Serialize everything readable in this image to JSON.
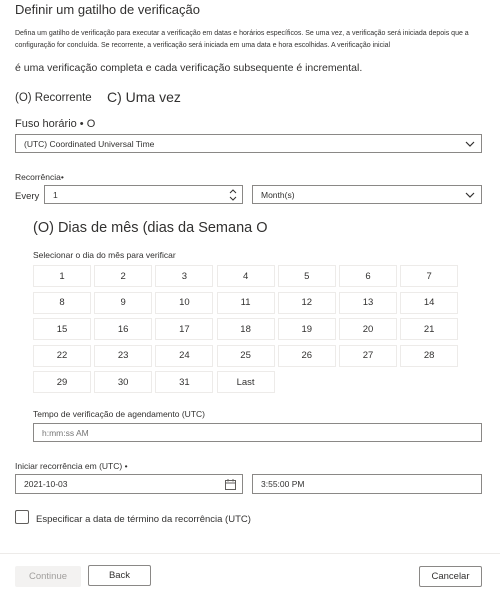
{
  "dialog": {
    "title": "Definir um gatilho de verificação",
    "description": "Defina um gatilho de verificação para executar a verificação em datas e horários específicos. Se uma vez, a verificação será iniciada depois que a configuração for concluída. Se recorrente, a verificação será iniciada em uma data e hora escolhidas. A verificação inicial",
    "description_tail": "é uma verificação completa e cada verificação subsequente é incremental."
  },
  "trigger": {
    "recurring_label": "(O) Recorrente",
    "once_label": "C) Uma vez"
  },
  "timezone": {
    "label": "Fuso horário • O",
    "value": "(UTC) Coordinated Universal Time"
  },
  "recurrence": {
    "label": "Recorrência•",
    "every_label": "Every",
    "interval_value": "1",
    "unit_value": "Month(s)"
  },
  "day_mode": {
    "label": "(O) Dias de mês (dias da Semana O"
  },
  "day_picker": {
    "label": "Selecionar o dia do mês para verificar",
    "days": [
      "1",
      "2",
      "3",
      "4",
      "5",
      "6",
      "7",
      "8",
      "9",
      "10",
      "11",
      "12",
      "13",
      "14",
      "15",
      "16",
      "17",
      "18",
      "19",
      "20",
      "21",
      "22",
      "23",
      "24",
      "25",
      "26",
      "27",
      "28",
      "29",
      "30",
      "31",
      "Last"
    ]
  },
  "schedule_time": {
    "label": "Tempo de verificação de agendamento (UTC)",
    "placeholder": "h:mm:ss AM"
  },
  "start": {
    "label": "Iniciar recorrência em (UTC) •",
    "date_value": "2021-10-03",
    "time_value": "3:55:00 PM"
  },
  "end_date": {
    "label": "Especificar a data de término da recorrência (UTC)"
  },
  "footer": {
    "continue_label": "Continue",
    "back_label": "Back",
    "cancel_label": "Cancelar"
  }
}
